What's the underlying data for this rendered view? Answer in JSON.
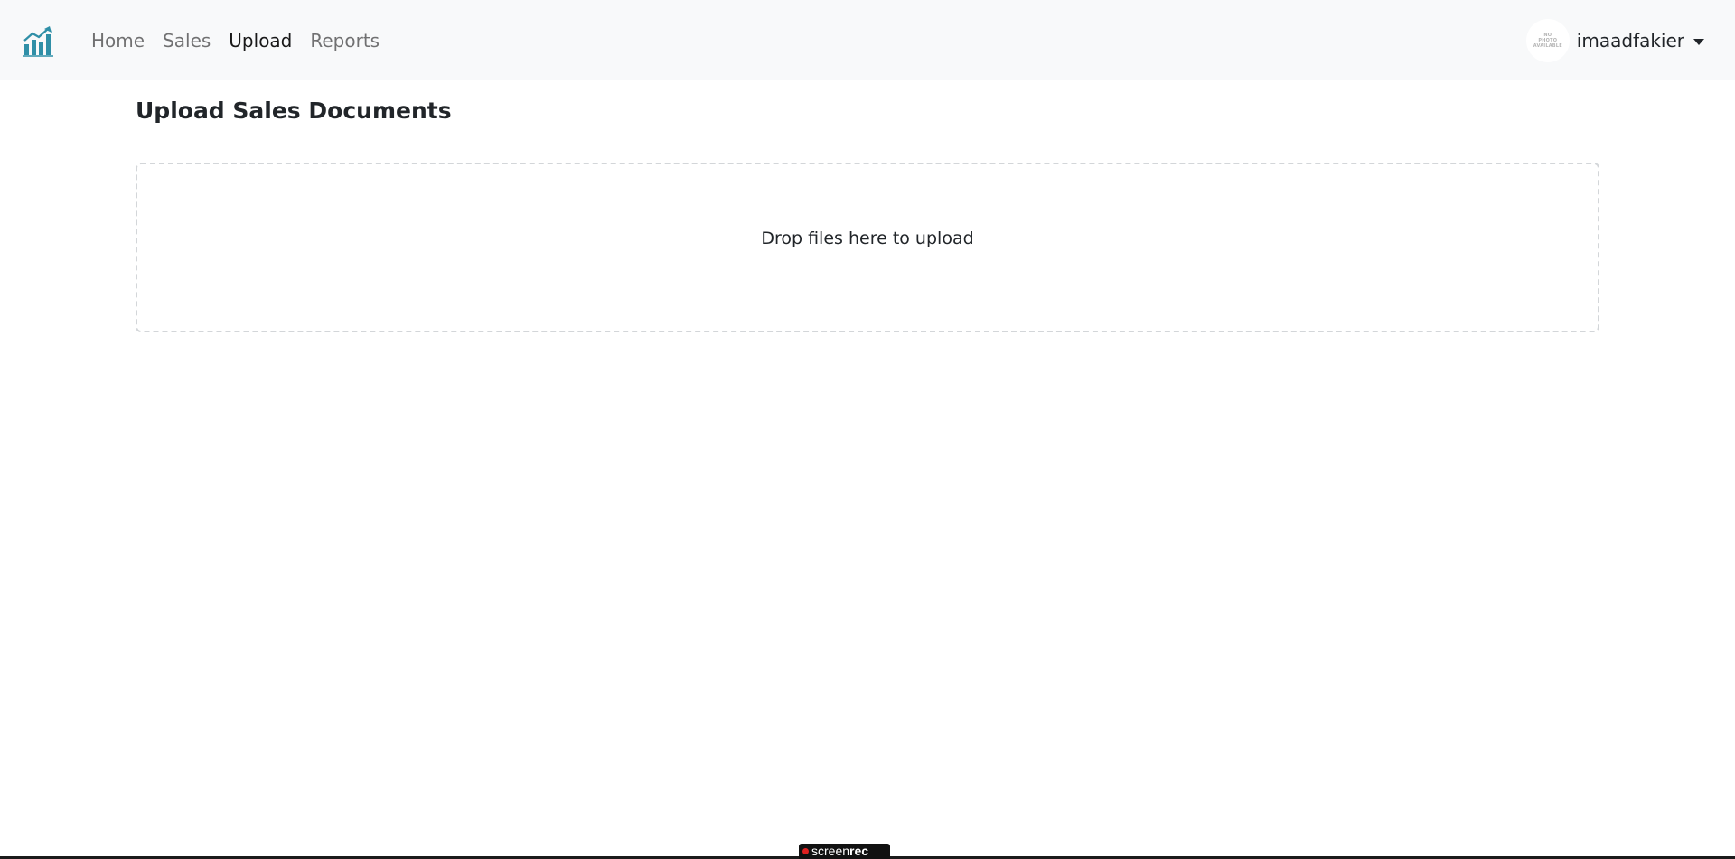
{
  "navbar": {
    "brand_icon": "bar-chart-growth-icon",
    "brand_color": "#2f8fa7",
    "links": [
      {
        "label": "Home",
        "active": false
      },
      {
        "label": "Sales",
        "active": false
      },
      {
        "label": "Upload",
        "active": true
      },
      {
        "label": "Reports",
        "active": false
      }
    ],
    "user": {
      "avatar_text": [
        "NO",
        "PHOTO",
        "AVAILABLE"
      ],
      "username": "imaadfakier"
    }
  },
  "main": {
    "title": "Upload Sales Documents",
    "dropzone_text": "Drop files here to upload"
  },
  "watermark": {
    "text_regular": "screen",
    "text_bold": "rec"
  }
}
